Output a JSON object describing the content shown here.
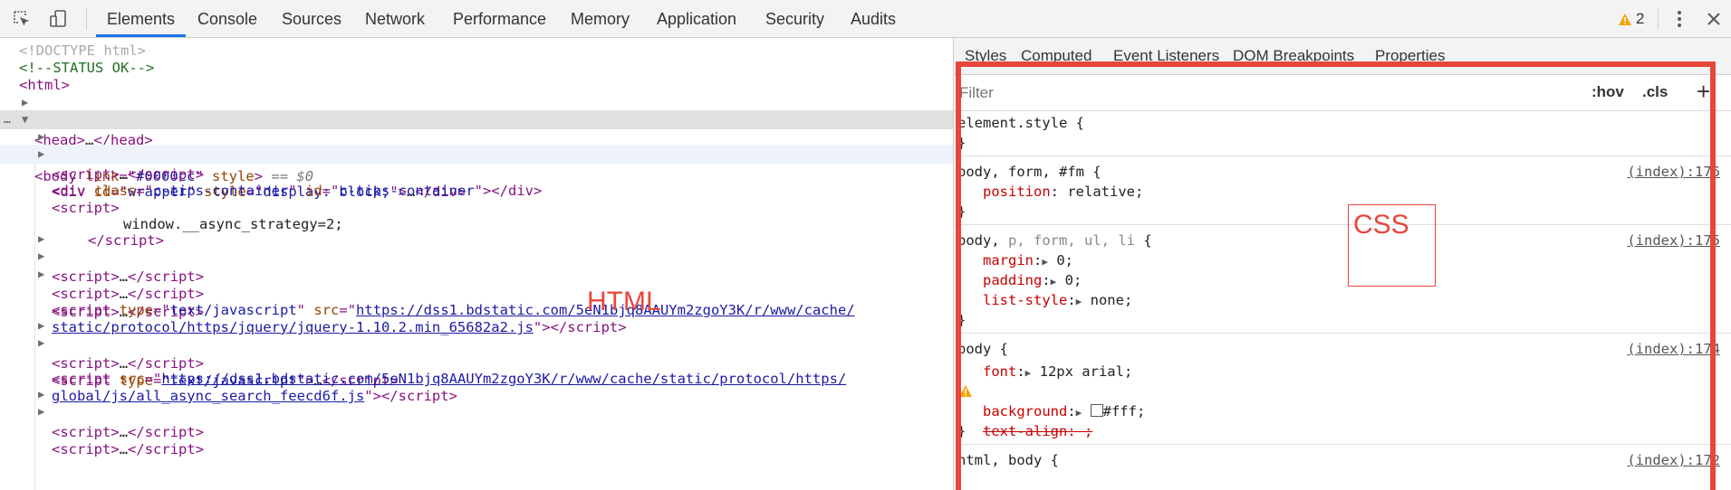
{
  "toolbar": {
    "tabs": [
      "Elements",
      "Console",
      "Sources",
      "Network",
      "Performance",
      "Memory",
      "Application",
      "Security",
      "Audits"
    ],
    "active_tab": "Elements",
    "warning_count": "2",
    "accent": "#1a73e8"
  },
  "dom": {
    "doctype": "<!DOCTYPE html>",
    "comment": "<!--STATUS OK-->",
    "html_open": "<html>",
    "head_tag": "head",
    "body_tag": "body",
    "body_link_attr": "link",
    "body_link_val": "#0000cc",
    "body_style_attr": "style",
    "body_eq": "== $0",
    "script_tag": "script",
    "wrapper_id": "wrapper",
    "wrapper_style": "display: block;",
    "tips_class": "c-tips-container",
    "tips_id": "c-tips-container",
    "async_text": "window.__async_strategy=2;",
    "js_type": "text/javascript",
    "jquery_src_1": "https://dss1.bdstatic.com/5eN1bjq8AAUYm2zgoY3K/r/www/cache/",
    "jquery_src_2": "static/protocol/https/jquery/jquery-1.10.2.min_65682a2.js",
    "async_src_1": "https://dss1.bdstatic.com/5eN1bjq8AAUYm2zgoY3K/r/www/cache/static/protocol/https/",
    "async_src_2": "global/js/all_async_search_feecd6f.js",
    "annotation": "HTML"
  },
  "styles": {
    "subtabs": [
      "Styles",
      "Computed",
      "Event Listeners",
      "DOM Breakpoints",
      "Properties"
    ],
    "filter_placeholder": "Filter",
    "hov": ":hov",
    "cls": ".cls",
    "element_style": "element.style {",
    "rule1_sel": "body, form, #fm {",
    "rule1_src": "(index):176",
    "rule1_prop": "position",
    "rule1_val": "relative;",
    "rule2_sel_a": "body,",
    "rule2_sel_b": " p, form, ul, li",
    "rule2_sel_c": " {",
    "rule2_src": "(index):175",
    "margin": "margin",
    "margin_val": "0;",
    "padding": "padding",
    "padding_val": "0;",
    "list_style": "list-style",
    "list_style_val": "none;",
    "rule3_sel": "body {",
    "rule3_src": "(index):174",
    "font": "font",
    "font_val": "12px arial;",
    "text_align": "text-align: ;",
    "background": "background",
    "background_val": "#fff;",
    "rule4_sel": "html, body {",
    "rule4_src": "(index):172",
    "close": "}",
    "annotation": "CSS",
    "annotation_color": "#e8463c"
  }
}
